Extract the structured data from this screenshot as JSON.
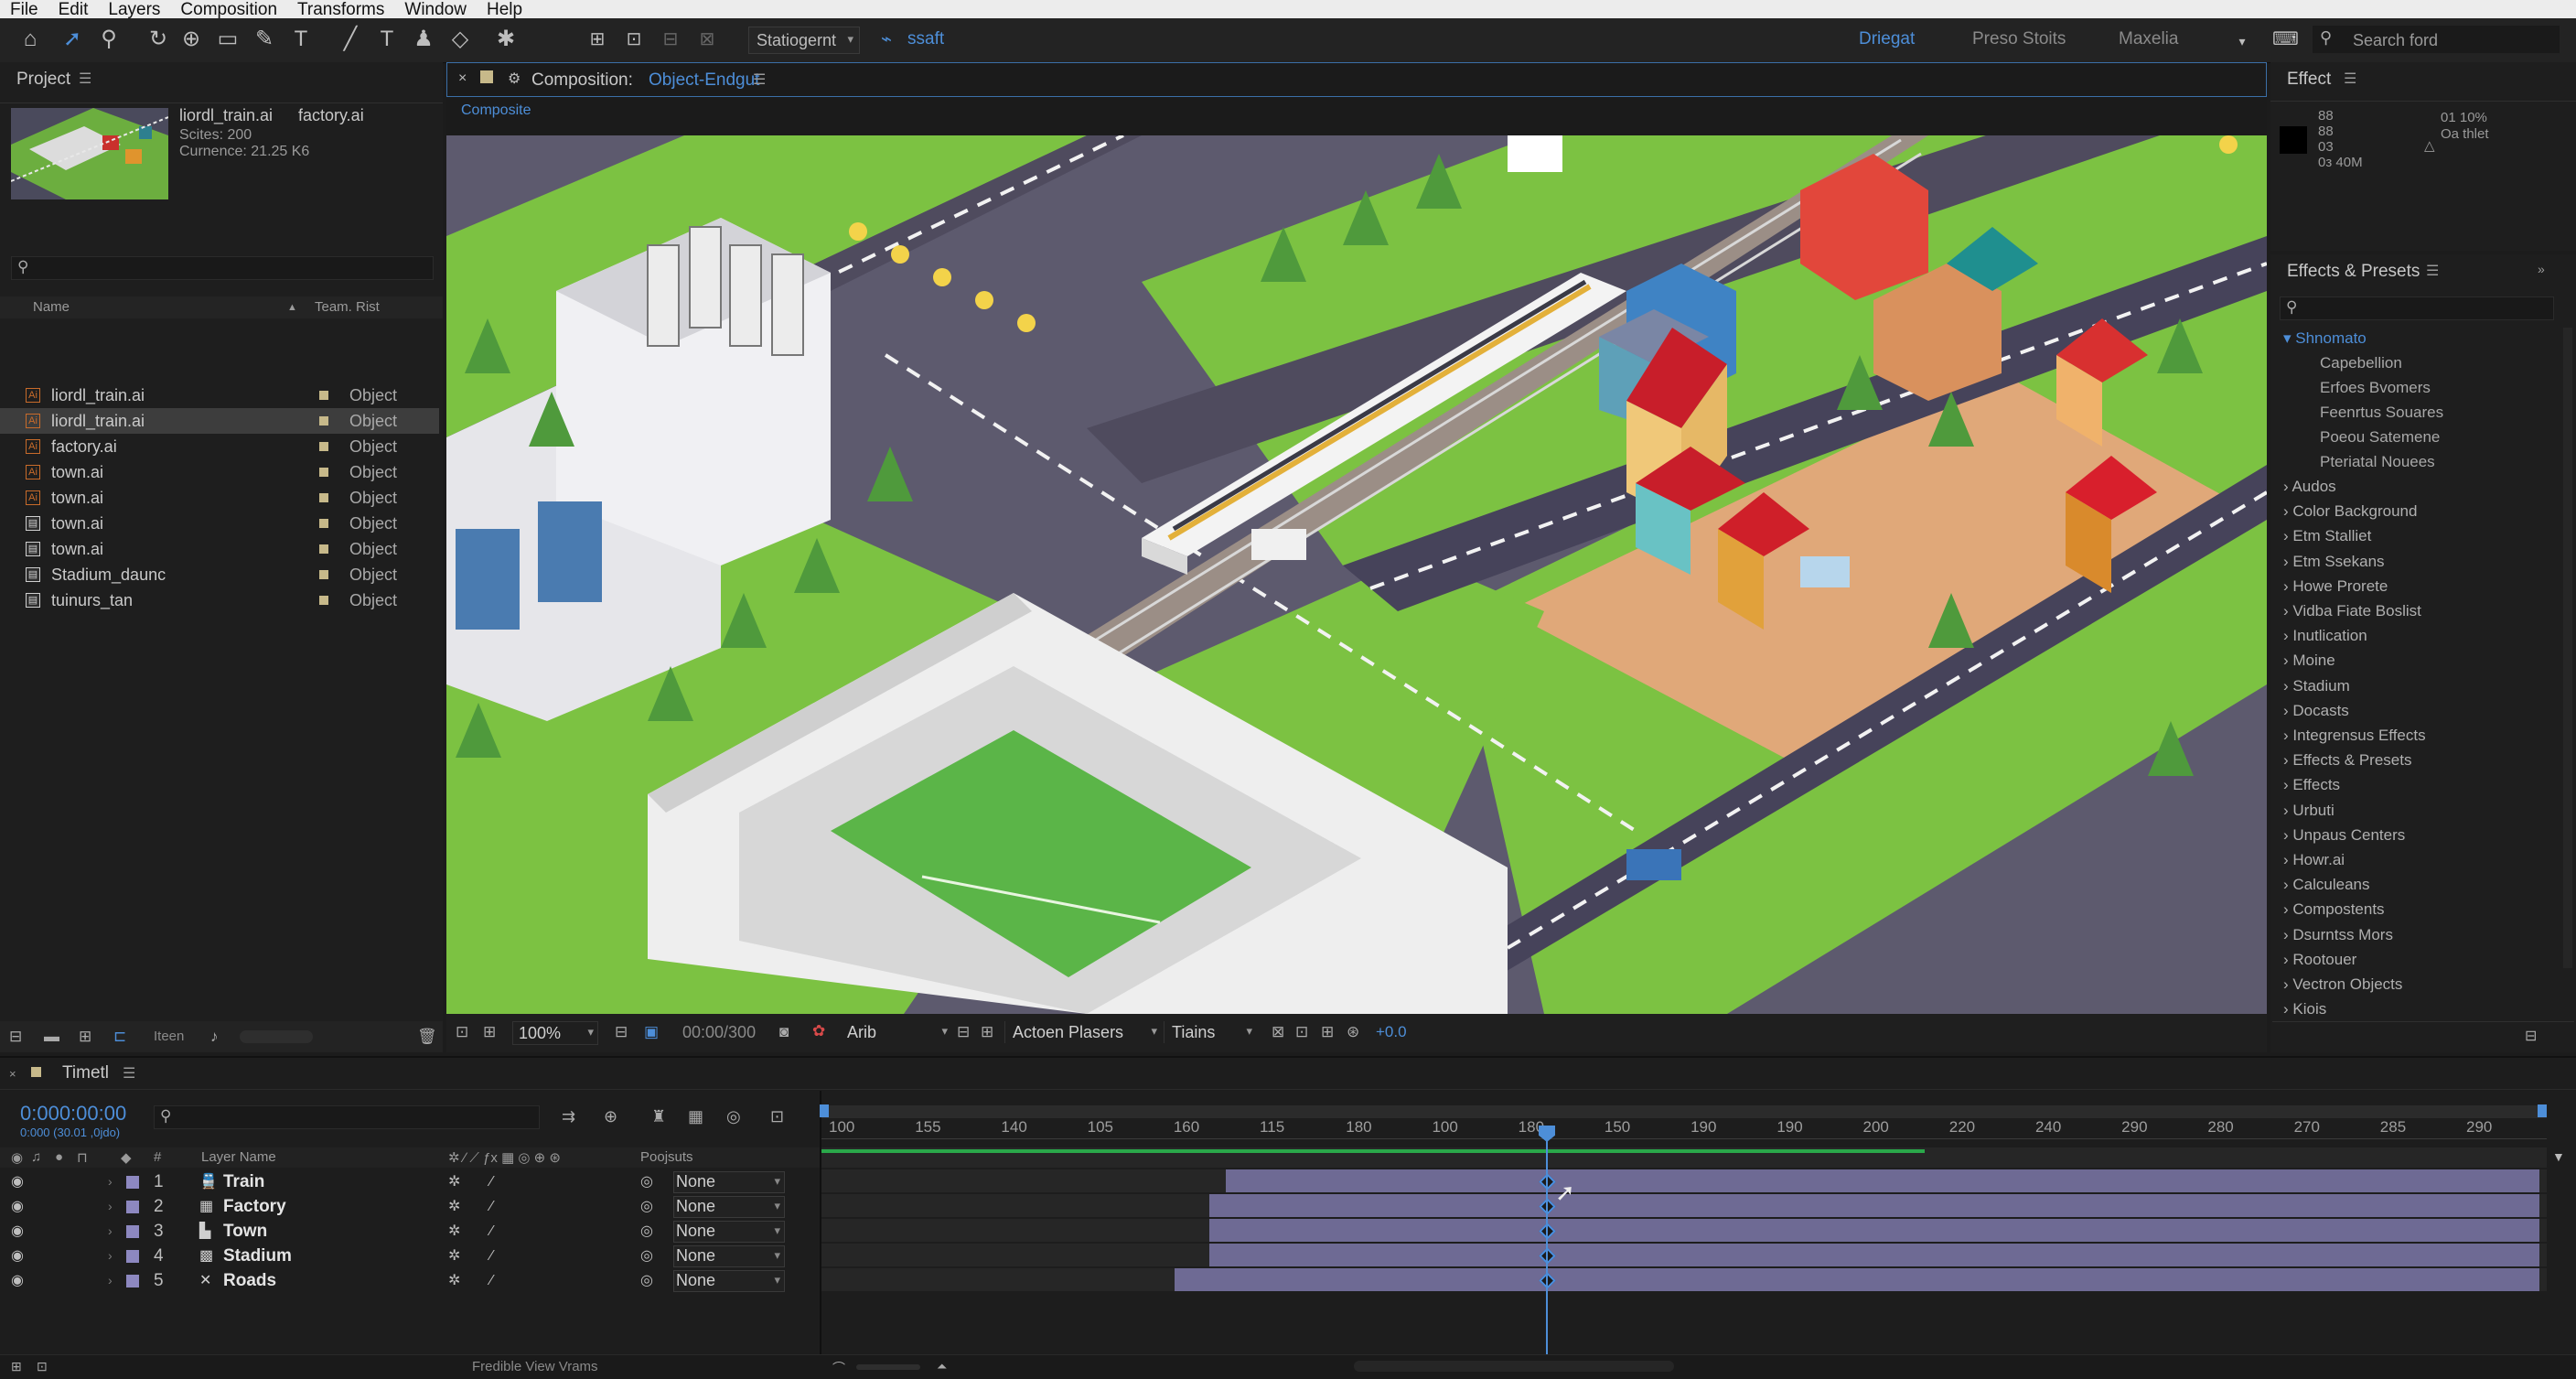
{
  "menu": [
    "File",
    "Edit",
    "Layers",
    "Composition",
    "Transforms",
    "Window",
    "Help"
  ],
  "toolbar": {
    "dropdown_label": "Statiogernt",
    "small_label": "ssaft",
    "workspaces": [
      "Driegat",
      "Preso Stoits",
      "Maxelia"
    ],
    "search_placeholder": "Search ford"
  },
  "project": {
    "title": "Project",
    "thumb_name": "liordl_train.ai",
    "thumb_name2": "factory.ai",
    "thumb_info1": "Scites: 200",
    "thumb_info2": "Curnence: 21.25 K6",
    "col_name": "Name",
    "col_type": "Team. Rist",
    "items": [
      {
        "name": "liordl_train.ai",
        "type": "Object",
        "icon": "ai-file-icon",
        "selected": false
      },
      {
        "name": "liordl_train.ai",
        "type": "Object",
        "icon": "ai-file-icon",
        "selected": true
      },
      {
        "name": "factory.ai",
        "type": "Object",
        "icon": "ai-file-icon",
        "selected": false
      },
      {
        "name": "town.ai",
        "type": "Object",
        "icon": "ai-file-icon",
        "selected": false
      },
      {
        "name": "town.ai",
        "type": "Object",
        "icon": "ai-file-icon",
        "selected": false
      },
      {
        "name": "town.ai",
        "type": "Object",
        "icon": "composition-icon",
        "selected": false
      },
      {
        "name": "town.ai",
        "type": "Object",
        "icon": "composition-icon",
        "selected": false
      },
      {
        "name": "Stadium_daunc",
        "type": "Object",
        "icon": "composition-icon",
        "selected": false
      },
      {
        "name": "tuinurs_tan",
        "type": "Object",
        "icon": "composition-icon",
        "selected": false
      }
    ],
    "footer_label": "Iteen"
  },
  "composition": {
    "tab_prefix": "Composition: ",
    "tab_name": "Object-Endgut",
    "sub_tab": "Composite",
    "zoom": "100%",
    "timecode": "00:00/300",
    "channel": "Arib",
    "view": "Actoen Plasers",
    "views_label": "Tiains"
  },
  "effect": {
    "title": "Effect",
    "left_values": [
      "88",
      "88",
      "03",
      "0з 40M"
    ],
    "right_values": [
      "01 10%",
      "Oa thlet"
    ]
  },
  "effects_presets": {
    "title": "Effects & Presets",
    "open_group": "Shnomato",
    "sub_items": [
      "Capebellion",
      "Erfoes Bvomers",
      "Feenrtus Souares",
      "Poeou Satemene",
      "Pteriatal Nouees"
    ],
    "groups": [
      "Audos",
      "Color Background",
      "Etm Stalliet",
      "Etm Ssekans",
      "Howe Prorete",
      "Vidba Fiate Boslist",
      "Inutlication",
      "Moine",
      "Stadium",
      "Docasts",
      "Integrensus Effects",
      "Effects & Presets",
      "Effects",
      "Urbuti",
      "Unpaus Centers",
      "Howr.ai",
      "Calculeans",
      "Compostents",
      "Dsurntss Mors",
      "Rootouer",
      "Vectron Objects",
      "Kiois"
    ]
  },
  "timeline": {
    "title": "Timetl",
    "current_time": "0:000:00:00",
    "frame_info": "0:000 (30.01 ,0jdo)",
    "col_layer_name": "Layer Name",
    "col_parent": "Poojsuts",
    "ruler": [
      "100",
      "155",
      "140",
      "105",
      "160",
      "115",
      "180",
      "100",
      "180",
      "150",
      "190",
      "190",
      "200",
      "220",
      "240",
      "290",
      "280",
      "270",
      "285",
      "290"
    ],
    "playhead_frame": "150",
    "layers": [
      {
        "num": "1",
        "name": "Train",
        "parent": "None",
        "icon": "train-icon"
      },
      {
        "num": "2",
        "name": "Factory",
        "parent": "None",
        "icon": "factory-icon"
      },
      {
        "num": "3",
        "name": "Town",
        "parent": "None",
        "icon": "town-icon"
      },
      {
        "num": "4",
        "name": "Stadium",
        "parent": "None",
        "icon": "stadium-icon"
      },
      {
        "num": "5",
        "name": "Roads",
        "parent": "None",
        "icon": "roads-icon"
      }
    ],
    "footer_label": "Fredible View Vrams"
  },
  "colors": {
    "accent": "#4d8ed8",
    "layer_label": "#8d88c0",
    "layer_bar": "#6e6a94",
    "work_area": "#2aa84a"
  }
}
